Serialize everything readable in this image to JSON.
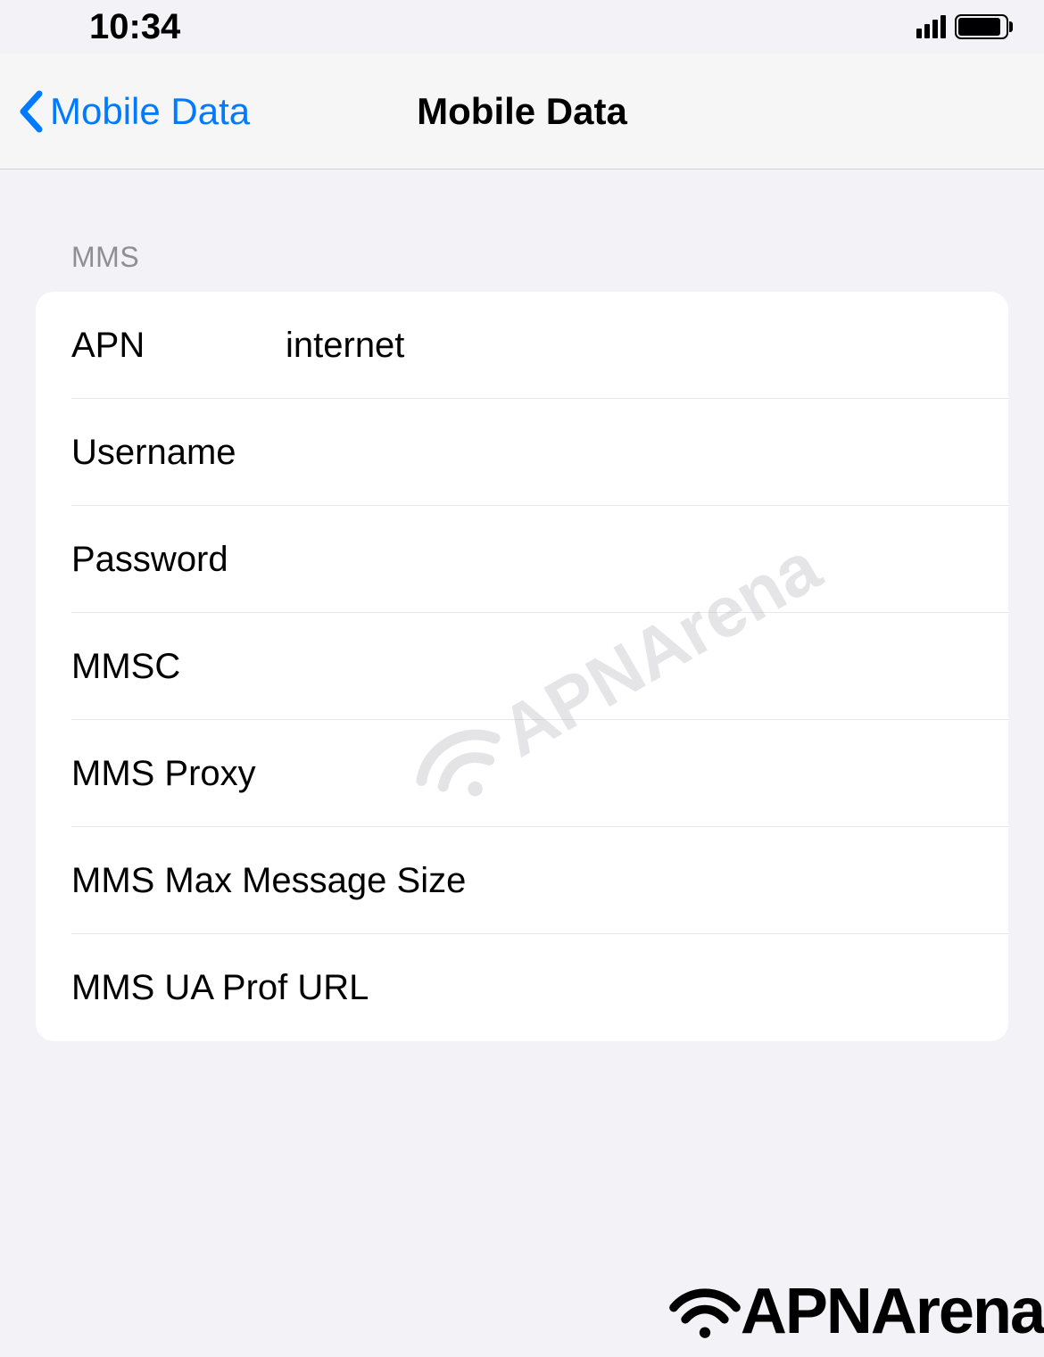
{
  "statusBar": {
    "time": "10:34"
  },
  "nav": {
    "backLabel": "Mobile Data",
    "title": "Mobile Data"
  },
  "section": {
    "header": "MMS",
    "rows": [
      {
        "label": "APN",
        "value": "internet"
      },
      {
        "label": "Username",
        "value": ""
      },
      {
        "label": "Password",
        "value": ""
      },
      {
        "label": "MMSC",
        "value": ""
      },
      {
        "label": "MMS Proxy",
        "value": ""
      },
      {
        "label": "MMS Max Message Size",
        "value": ""
      },
      {
        "label": "MMS UA Prof URL",
        "value": ""
      }
    ]
  },
  "watermark": "APNArena"
}
